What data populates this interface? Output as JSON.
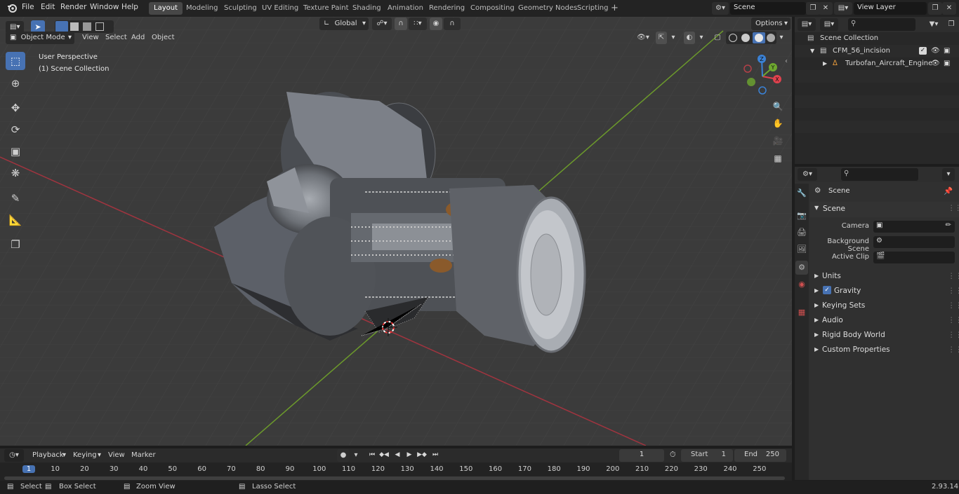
{
  "app": {
    "version": "2.93.14"
  },
  "menu": {
    "file": "File",
    "edit": "Edit",
    "render": "Render",
    "window": "Window",
    "help": "Help"
  },
  "workspaces": [
    {
      "label": "Layout",
      "active": true
    },
    {
      "label": "Modeling"
    },
    {
      "label": "Sculpting"
    },
    {
      "label": "UV Editing"
    },
    {
      "label": "Texture Paint"
    },
    {
      "label": "Shading"
    },
    {
      "label": "Animation"
    },
    {
      "label": "Rendering"
    },
    {
      "label": "Compositing"
    },
    {
      "label": "Geometry Nodes"
    },
    {
      "label": "Scripting"
    }
  ],
  "scene_selector": {
    "value": "Scene"
  },
  "view_layer_selector": {
    "value": "View Layer"
  },
  "viewport_header": {
    "mode": "Object Mode",
    "view": "View",
    "select": "Select",
    "add": "Add",
    "object": "Object",
    "orientation": "Global",
    "options": "Options"
  },
  "viewport": {
    "perspective_label": "User Perspective",
    "collection_label": "(1) Scene Collection",
    "gizmo": {
      "x": "X",
      "y": "Y",
      "z": "Z"
    }
  },
  "outliner": {
    "root": "Scene Collection",
    "items": [
      {
        "label": "CFM_56_incision",
        "indent": 1
      },
      {
        "label": "Turbofan_Aircraft_Engine",
        "indent": 2
      }
    ]
  },
  "properties": {
    "context": "Scene",
    "panel": "Scene",
    "fields": [
      {
        "label": "Camera"
      },
      {
        "label": "Background Scene"
      },
      {
        "label": "Active Clip"
      }
    ],
    "sections": [
      {
        "label": "Units"
      },
      {
        "label": "Gravity",
        "checked": true
      },
      {
        "label": "Keying Sets"
      },
      {
        "label": "Audio"
      },
      {
        "label": "Rigid Body World"
      },
      {
        "label": "Custom Properties"
      }
    ]
  },
  "timeline": {
    "playback": "Playback",
    "keying": "Keying",
    "view": "View",
    "marker": "Marker",
    "current_frame": "1",
    "start_label": "Start",
    "start_value": "1",
    "end_label": "End",
    "end_value": "250",
    "ticks": [
      "1",
      "10",
      "20",
      "30",
      "40",
      "50",
      "60",
      "70",
      "80",
      "90",
      "100",
      "110",
      "120",
      "130",
      "140",
      "150",
      "160",
      "170",
      "180",
      "190",
      "200",
      "210",
      "220",
      "230",
      "240",
      "250"
    ]
  },
  "status": {
    "select": "Select",
    "box_select": "Box Select",
    "zoom_view": "Zoom View",
    "lasso_select": "Lasso Select"
  }
}
